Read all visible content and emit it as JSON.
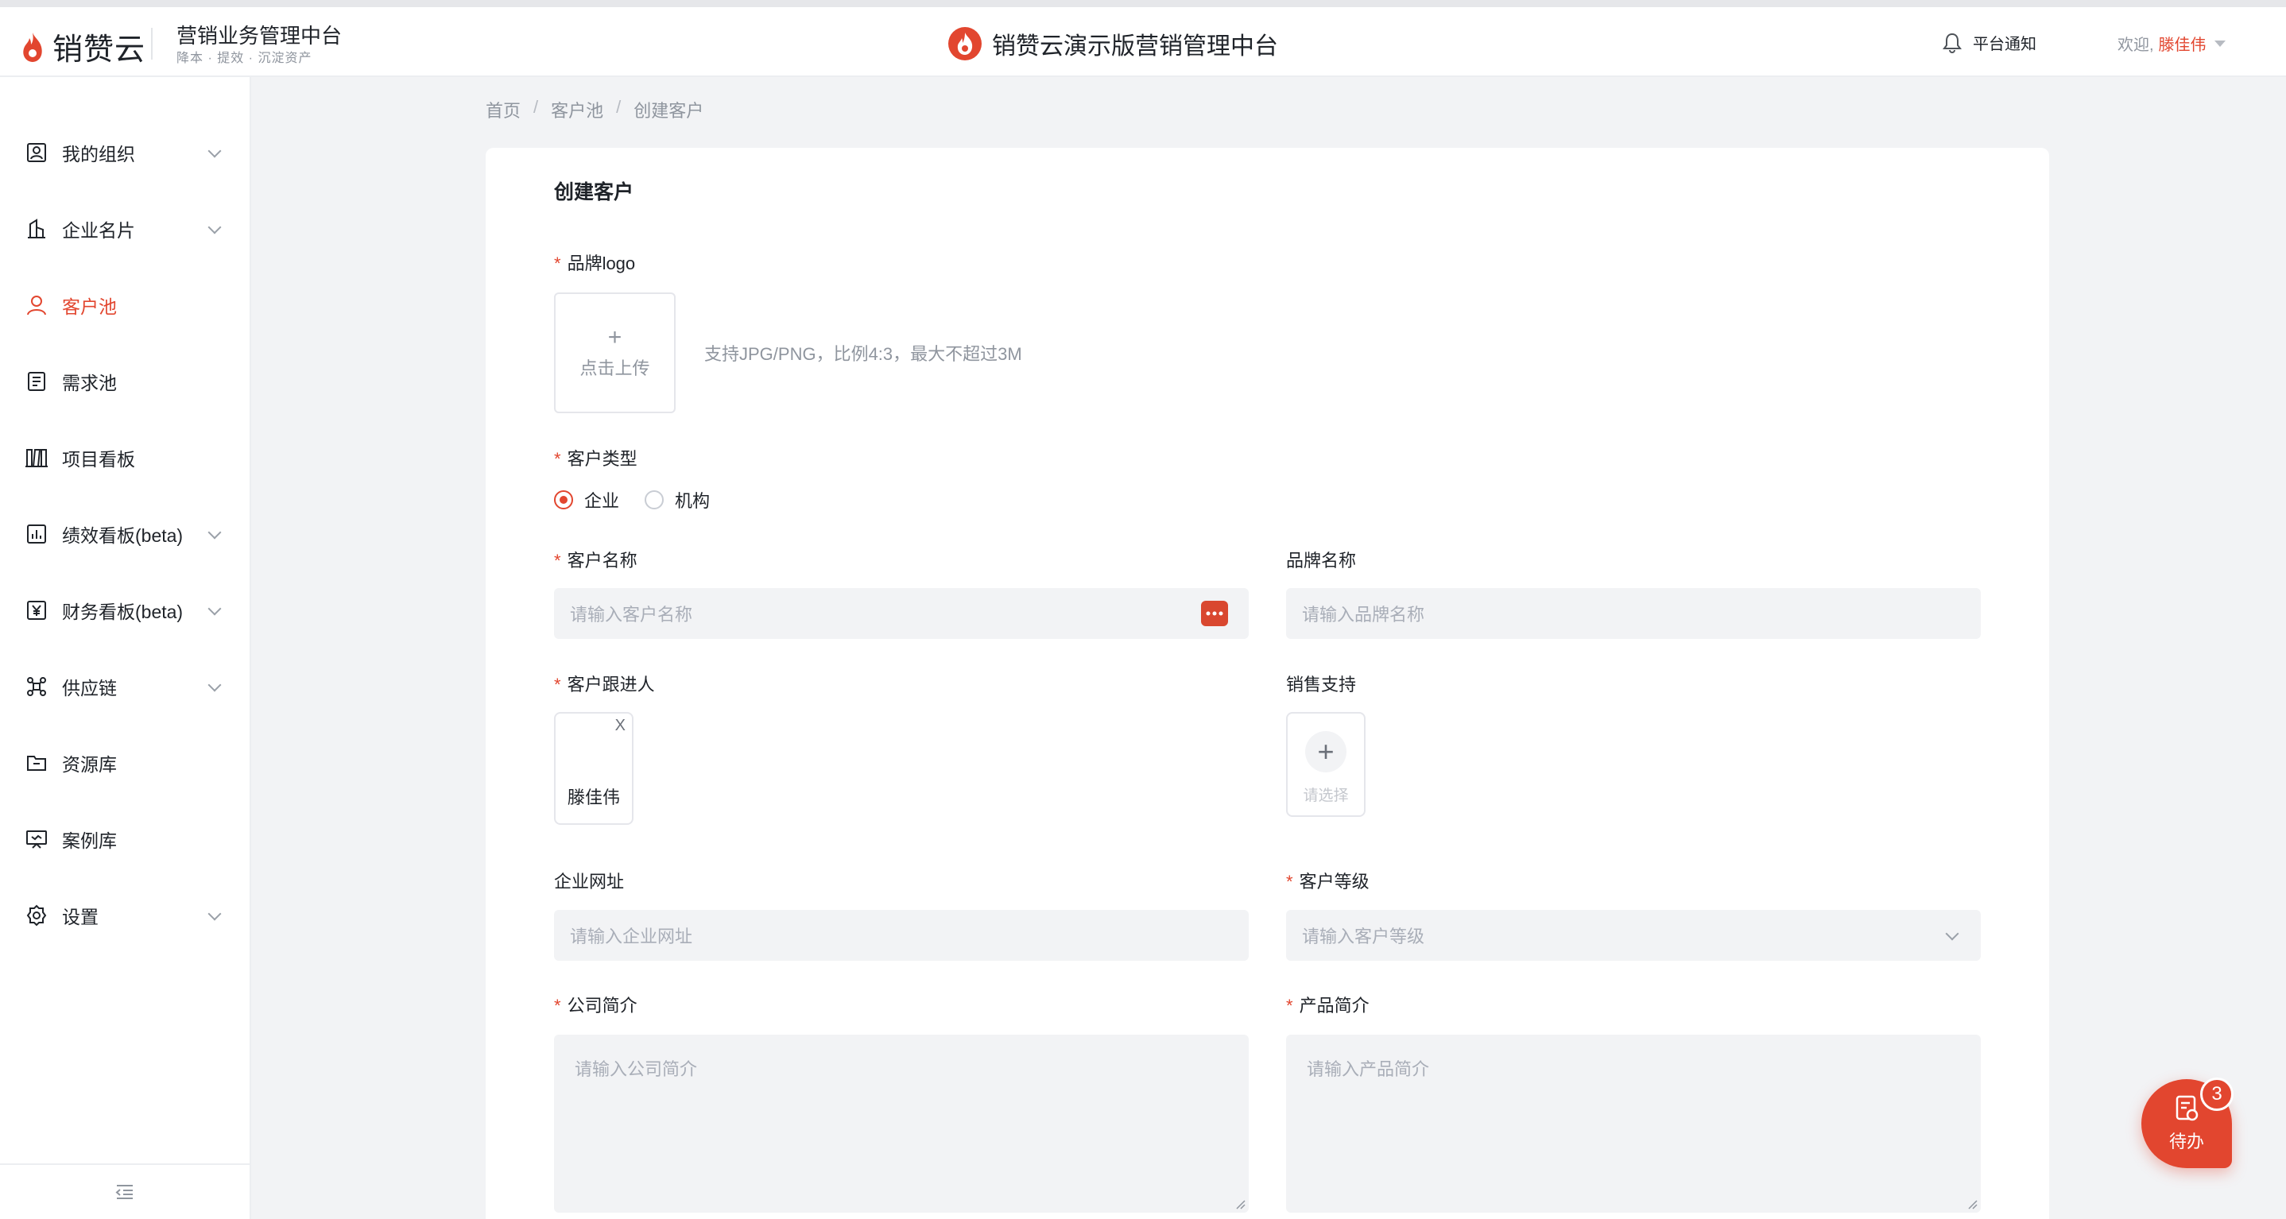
{
  "header": {
    "logo_text": "销赞云",
    "system_title": "营销业务管理中台",
    "system_subtitle": "降本 · 提效 · 沉淀资产",
    "center_title": "销赞云演示版营销管理中台",
    "notice_label": "平台通知",
    "welcome_label": "欢迎,",
    "user_name": "滕佳伟"
  },
  "sidebar": {
    "items": [
      {
        "label": "我的组织",
        "icon": "org-icon",
        "expandable": true,
        "active": false
      },
      {
        "label": "企业名片",
        "icon": "building-icon",
        "expandable": true,
        "active": false
      },
      {
        "label": "客户池",
        "icon": "user-icon",
        "expandable": false,
        "active": true
      },
      {
        "label": "需求池",
        "icon": "document-icon",
        "expandable": false,
        "active": false
      },
      {
        "label": "项目看板",
        "icon": "board-icon",
        "expandable": false,
        "active": false
      },
      {
        "label": "绩效看板(beta)",
        "icon": "chart-icon",
        "expandable": true,
        "active": false
      },
      {
        "label": "财务看板(beta)",
        "icon": "yuan-icon",
        "expandable": true,
        "active": false
      },
      {
        "label": "供应链",
        "icon": "network-icon",
        "expandable": true,
        "active": false
      },
      {
        "label": "资源库",
        "icon": "folder-icon",
        "expandable": false,
        "active": false
      },
      {
        "label": "案例库",
        "icon": "presentation-icon",
        "expandable": false,
        "active": false
      },
      {
        "label": "设置",
        "icon": "gear-icon",
        "expandable": true,
        "active": false
      }
    ]
  },
  "breadcrumb": [
    "首页",
    "客户池",
    "创建客户"
  ],
  "form": {
    "title": "创建客户",
    "brand_logo": {
      "label": "品牌logo",
      "upload_plus": "+",
      "upload_text": "点击上传",
      "hint": "支持JPG/PNG，比例4:3，最大不超过3M"
    },
    "customer_type": {
      "label": "客户类型",
      "options": [
        "企业",
        "机构"
      ],
      "selected": "企业"
    },
    "customer_name": {
      "label": "客户名称",
      "placeholder": "请输入客户名称"
    },
    "brand_name": {
      "label": "品牌名称",
      "placeholder": "请输入品牌名称"
    },
    "follower": {
      "label": "客户跟进人",
      "person": "滕佳伟",
      "remove": "X"
    },
    "sales_support": {
      "label": "销售支持",
      "select_text": "请选择",
      "plus": "+"
    },
    "website": {
      "label": "企业网址",
      "placeholder": "请输入企业网址"
    },
    "level": {
      "label": "客户等级",
      "placeholder": "请输入客户等级"
    },
    "company_intro": {
      "label": "公司简介",
      "placeholder": "请输入公司简介"
    },
    "product_intro": {
      "label": "产品简介",
      "placeholder": "请输入产品简介"
    },
    "required_mark": "*"
  },
  "todo": {
    "label": "待办",
    "count": "3"
  },
  "colors": {
    "accent": "#e2462f",
    "background": "#f2f3f5"
  }
}
